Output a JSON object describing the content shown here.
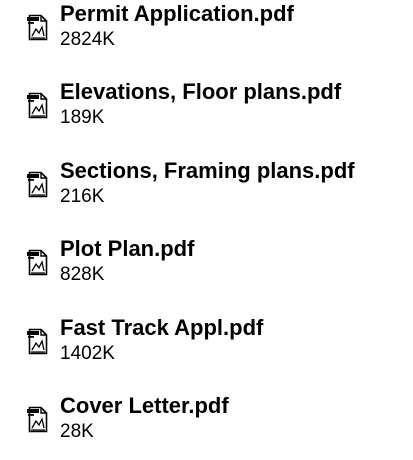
{
  "files": [
    {
      "name": "Permit Application.pdf",
      "size": "2824K",
      "icon": "pdf-file-icon"
    },
    {
      "name": "Elevations, Floor plans.pdf",
      "size": "189K",
      "icon": "pdf-file-icon"
    },
    {
      "name": "Sections, Framing plans.pdf",
      "size": "216K",
      "icon": "pdf-file-icon"
    },
    {
      "name": "Plot Plan.pdf",
      "size": "828K",
      "icon": "pdf-file-icon"
    },
    {
      "name": "Fast Track Appl.pdf",
      "size": "1402K",
      "icon": "pdf-file-icon"
    },
    {
      "name": "Cover Letter.pdf",
      "size": "28K",
      "icon": "pdf-file-icon"
    }
  ]
}
